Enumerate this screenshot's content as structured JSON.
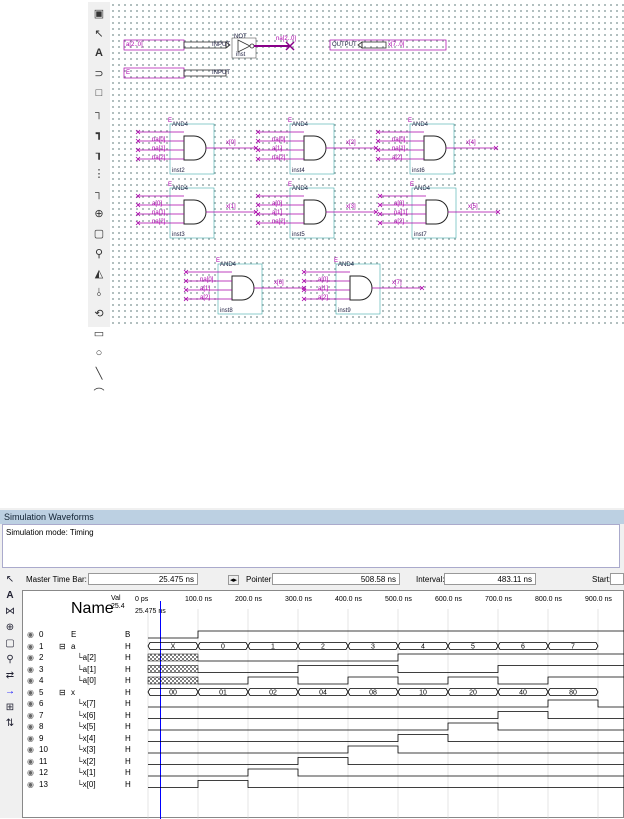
{
  "schematic": {
    "input_a": "a[2..0]",
    "input_e": "E",
    "not_label": "NOT",
    "na_label": "na[2..0]",
    "output_label": "x[7..0]",
    "input_sym": "INPUT",
    "output_sym": "OUTPUT",
    "inst_not": "inst",
    "gates": [
      {
        "e": "E",
        "ins": [
          "na[0]",
          "na[1]",
          "na[2]"
        ],
        "out": "x[0]",
        "inst": "inst2"
      },
      {
        "e": "E",
        "ins": [
          "na[0]",
          "a[1]",
          "na[2]"
        ],
        "out": "x[2]",
        "inst": "inst4"
      },
      {
        "e": "E",
        "ins": [
          "na[0]",
          "na[1]",
          "a[2]"
        ],
        "out": "x[4]",
        "inst": "inst6"
      },
      {
        "e": "E",
        "ins": [
          "a[0]",
          "na[1]",
          "na[2]"
        ],
        "out": "x[1]",
        "inst": "inst3"
      },
      {
        "e": "E",
        "ins": [
          "a[0]",
          "a[1]",
          "na[2]"
        ],
        "out": "x[3]",
        "inst": "inst5"
      },
      {
        "e": "E",
        "ins": [
          "a[0]",
          "na[1]",
          "a[2]"
        ],
        "out": "x[5]",
        "inst": "inst7"
      },
      {
        "e": "E",
        "ins": [
          "na[0]",
          "a[1]",
          "a[2]"
        ],
        "out": "x[6]",
        "inst": "inst8"
      },
      {
        "e": "E",
        "ins": [
          "a[0]",
          "a[1]",
          "a[2]"
        ],
        "out": "x[7]",
        "inst": "inst9"
      }
    ],
    "gate_type": "AND4"
  },
  "simulation": {
    "title": "Simulation Waveforms",
    "mode": "Simulation mode: Timing",
    "master_time_label": "Master Time Bar:",
    "master_time": "25.475 ns",
    "pointer_label": "Pointer:",
    "pointer": "508.58 ns",
    "interval_label": "Interval:",
    "interval": "483.11 ns",
    "start_label": "Start:",
    "name_header": "Name",
    "value_header": "Val 25.4",
    "time_ticks": [
      "0 ps",
      "100.0 ns",
      "200.0 ns",
      "300.0 ns",
      "400.0 ns",
      "500.0 ns",
      "600.0 ns",
      "700.0 ns",
      "800.0 ns",
      "900.0 ns"
    ],
    "cursor_label": "25.475 ns",
    "rows": [
      {
        "idx": "0",
        "name": "E",
        "val": "B",
        "group": false
      },
      {
        "idx": "1",
        "name": "a",
        "val": "H",
        "group": true
      },
      {
        "idx": "2",
        "name": "a[2]",
        "val": "H",
        "group": false
      },
      {
        "idx": "3",
        "name": "a[1]",
        "val": "H",
        "group": false
      },
      {
        "idx": "4",
        "name": "a[0]",
        "val": "H",
        "group": false
      },
      {
        "idx": "5",
        "name": "x",
        "val": "H",
        "group": true
      },
      {
        "idx": "6",
        "name": "x[7]",
        "val": "H",
        "group": false
      },
      {
        "idx": "7",
        "name": "x[6]",
        "val": "H",
        "group": false
      },
      {
        "idx": "8",
        "name": "x[5]",
        "val": "H",
        "group": false
      },
      {
        "idx": "9",
        "name": "x[4]",
        "val": "H",
        "group": false
      },
      {
        "idx": "10",
        "name": "x[3]",
        "val": "H",
        "group": false
      },
      {
        "idx": "11",
        "name": "x[2]",
        "val": "H",
        "group": false
      },
      {
        "idx": "12",
        "name": "x[1]",
        "val": "H",
        "group": false
      },
      {
        "idx": "13",
        "name": "x[0]",
        "val": "H",
        "group": false
      }
    ],
    "a_bus": [
      "X",
      "0",
      "1",
      "2",
      "3",
      "4",
      "5",
      "6",
      "7"
    ],
    "x_bus": [
      "00",
      "01",
      "02",
      "04",
      "08",
      "10",
      "20",
      "40",
      "80"
    ]
  }
}
